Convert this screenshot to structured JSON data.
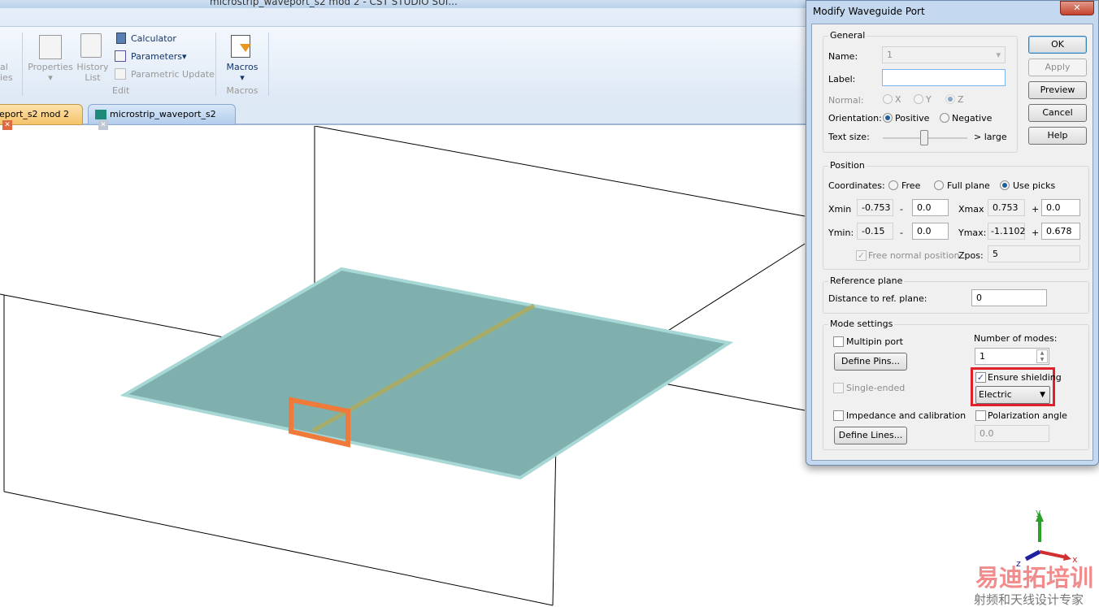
{
  "window": {
    "title": "microstrip_waveport_s2 mod 2 - CST STUDIO SUI..."
  },
  "ribbon": {
    "cut_label_1": "al",
    "cut_label_2": "ies",
    "properties": "Properties",
    "history": "History",
    "history_2": "List",
    "calculator": "Calculator",
    "parameters": "Parameters",
    "parametric_update": "Parametric Update",
    "edit_group": "Edit",
    "macros": "Macros",
    "macros_group": "Macros"
  },
  "tabs": [
    {
      "label": "eport_s2 mod 2",
      "active": true
    },
    {
      "label": "microstrip_waveport_s2",
      "active": false
    }
  ],
  "dialog": {
    "title": "Modify Waveguide Port",
    "buttons": {
      "ok": "OK",
      "apply": "Apply",
      "preview": "Preview",
      "cancel": "Cancel",
      "help": "Help"
    },
    "general": {
      "legend": "General",
      "name_label": "Name:",
      "name_value": "1",
      "label_label": "Label:",
      "label_value": "",
      "normal_label": "Normal:",
      "normal_options": [
        "X",
        "Y",
        "Z"
      ],
      "normal_selected": "Z",
      "orientation_label": "Orientation:",
      "orientation_options": [
        "Positive",
        "Negative"
      ],
      "orientation_selected": "Positive",
      "text_size_label": "Text size:",
      "text_size_max": "> large",
      "text_size_level": 0.5
    },
    "position": {
      "legend": "Position",
      "coordinates_label": "Coordinates:",
      "coordinate_options": [
        "Free",
        "Full plane",
        "Use picks"
      ],
      "coordinate_selected": "Use picks",
      "xmin_label": "Xmin",
      "xmin": "-0.753",
      "xmin_offset": "0.0",
      "xmax_label": "Xmax",
      "xmax": "0.753",
      "xmax_offset": "0.0",
      "ymin_label": "Ymin:",
      "ymin": "-0.15",
      "ymin_offset": "0.0",
      "ymax_label": "Ymax:",
      "ymax": "-1.1102",
      "ymax_offset": "0.678",
      "minus": "-",
      "plus": "+",
      "free_normal_label": "Free normal position",
      "free_normal_checked": true,
      "zpos_label": "Zpos:",
      "zpos": "5"
    },
    "reference": {
      "legend": "Reference plane",
      "distance_label": "Distance to ref. plane:",
      "distance": "0"
    },
    "mode": {
      "legend": "Mode settings",
      "multipin_label": "Multipin port",
      "multipin_checked": false,
      "define_pins": "Define Pins...",
      "single_ended_label": "Single-ended",
      "modes_label": "Number of modes:",
      "modes": "1",
      "ensure_shielding_label": "Ensure shielding",
      "ensure_shielding_checked": true,
      "shielding_type": "Electric",
      "impedance_label": "Impedance and calibration",
      "impedance_checked": false,
      "define_lines": "Define Lines...",
      "polarization_label": "Polarization angle",
      "polarization_checked": false,
      "polarization_value": "0.0"
    }
  },
  "axes": {
    "x": "x",
    "y": "y",
    "z": "z"
  },
  "watermark": {
    "line1": "易迪拓培训",
    "line2": "射频和天线设计专家"
  },
  "colors": {
    "highlight": "#e0202a",
    "port": "#f07a3a",
    "substrate": "#7fb0ae",
    "strip": "#b0ac5a"
  }
}
